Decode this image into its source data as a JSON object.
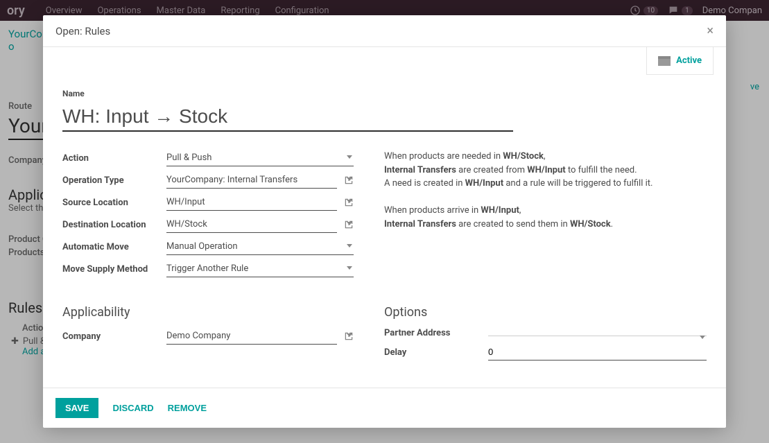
{
  "topbar": {
    "brand": "ory",
    "nav": [
      "Overview",
      "Operations",
      "Master Data",
      "Reporting",
      "Configuration"
    ],
    "notif_count": "10",
    "chat_count": "1",
    "company": "Demo Compan"
  },
  "bg": {
    "breadcrumb1": "YourCo",
    "breadcrumb2": "o",
    "route_label": "Route",
    "route_value": "Your",
    "company_label": "Company",
    "applic_heading": "Applic",
    "select_text": "Select the",
    "product_c": "Product C",
    "products": "Products",
    "rules": "Rules",
    "actio": "Actio",
    "pull_row": "Pull &",
    "add_a": "Add a",
    "ve": "ve"
  },
  "modal": {
    "title": "Open: Rules",
    "active_label": "Active",
    "name_label": "Name",
    "name_value": "WH: Input → Stock",
    "fields": {
      "action": {
        "label": "Action",
        "value": "Pull & Push"
      },
      "optype": {
        "label": "Operation Type",
        "value": "YourCompany: Internal Transfers"
      },
      "src": {
        "label": "Source Location",
        "value": "WH/Input"
      },
      "dest": {
        "label": "Destination Location",
        "value": "WH/Stock"
      },
      "automove": {
        "label": "Automatic Move",
        "value": "Manual Operation"
      },
      "supply": {
        "label": "Move Supply Method",
        "value": "Trigger Another Rule"
      }
    },
    "desc": {
      "p1_a": "When products are needed in ",
      "p1_b": "WH/Stock",
      "p1_c": ",",
      "p2_a": "Internal Transfers",
      "p2_b": " are created from ",
      "p2_c": "WH/Input",
      "p2_d": " to fulfill the need.",
      "p3_a": "A need is created in ",
      "p3_b": "WH/Input",
      "p3_c": " and a rule will be triggered to fulfill it.",
      "p4_a": "When products arrive in ",
      "p4_b": "WH/Input",
      "p4_c": ",",
      "p5_a": "Internal Transfers",
      "p5_b": " are created to send them in ",
      "p5_c": "WH/Stock",
      "p5_d": "."
    },
    "applicability": {
      "heading": "Applicability",
      "company_label": "Company",
      "company_value": "Demo Company"
    },
    "options": {
      "heading": "Options",
      "partner_label": "Partner Address",
      "partner_value": "",
      "delay_label": "Delay",
      "delay_value": "0"
    },
    "footer": {
      "save": "SAVE",
      "discard": "DISCARD",
      "remove": "REMOVE"
    }
  }
}
